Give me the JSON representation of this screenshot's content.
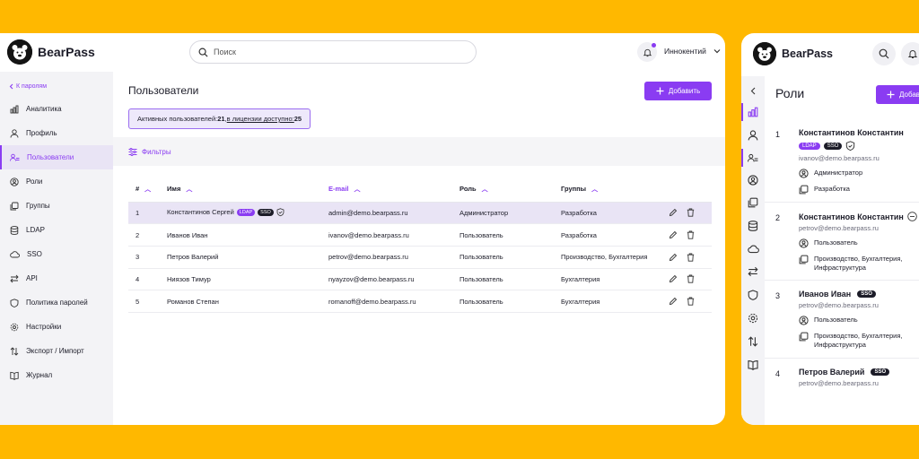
{
  "colors": {
    "accent": "#8A3CF2",
    "background": "#FFB800",
    "badge_sso": "#1c1c28"
  },
  "app": {
    "name": "BearPass"
  },
  "header": {
    "search_placeholder": "Поиск",
    "user_name": "Иннокентий"
  },
  "sidebar": {
    "back_label": "К паролям",
    "items": [
      {
        "label": "Аналитика",
        "icon": "analytics-icon"
      },
      {
        "label": "Профиль",
        "icon": "profile-icon"
      },
      {
        "label": "Пользователи",
        "icon": "users-icon",
        "active": true
      },
      {
        "label": "Роли",
        "icon": "roles-icon"
      },
      {
        "label": "Группы",
        "icon": "groups-icon"
      },
      {
        "label": "LDAP",
        "icon": "database-icon"
      },
      {
        "label": "SSO",
        "icon": "cloud-icon"
      },
      {
        "label": "API",
        "icon": "api-icon"
      },
      {
        "label": "Политика паролей",
        "icon": "shield-icon"
      },
      {
        "label": "Настройки",
        "icon": "gear-icon"
      },
      {
        "label": "Экспорт / Импорт",
        "icon": "import-export-icon"
      },
      {
        "label": "Журнал",
        "icon": "book-icon"
      }
    ]
  },
  "main": {
    "title": "Пользователи",
    "add_label": "Добавить",
    "license": {
      "prefix": "Активных пользователей: ",
      "active_count": "21",
      "sep": ", ",
      "link_text": "в лицензии доступно:",
      "space": " ",
      "available": "25"
    },
    "filters_label": "Фильтры",
    "columns": [
      "#",
      "Имя",
      "E-mail",
      "Роль",
      "Группы"
    ],
    "rows": [
      {
        "num": "1",
        "name": "Константинов Сергей",
        "badges": [
          "LDAP",
          "SSO"
        ],
        "email": "admin@demo.bearpass.ru",
        "role": "Администратор",
        "groups": "Разработка"
      },
      {
        "num": "2",
        "name": "Иванов Иван",
        "badges": [],
        "email": "ivanov@demo.bearpass.ru",
        "role": "Пользователь",
        "groups": "Разработка"
      },
      {
        "num": "3",
        "name": "Петров Валерий",
        "badges": [],
        "email": "petrov@demo.bearpass.ru",
        "role": "Пользователь",
        "groups": "Производство, Бухгалтерия"
      },
      {
        "num": "4",
        "name": "Ниязов Тимур",
        "badges": [],
        "email": "nyayzov@demo.bearpass.ru",
        "role": "Пользователь",
        "groups": "Бухгалтерия"
      },
      {
        "num": "5",
        "name": "Романов Степан",
        "badges": [],
        "email": "romanoff@demo.bearpass.ru",
        "role": "Пользователь",
        "groups": "Бухгалтерия"
      }
    ]
  },
  "mobile": {
    "title": "Роли",
    "add_label": "Добавить",
    "users": [
      {
        "num": "1",
        "name": "Константинов Константин",
        "badges": [
          "LDAP",
          "SSO"
        ],
        "email": "ivanov@demo.bearpass.ru",
        "role": "Администратор",
        "groups": "Разработка"
      },
      {
        "num": "2",
        "name": "Константинов Константин",
        "badges": [],
        "email": "petrov@demo.bearpass.ru",
        "role": "Пользователь",
        "groups": "Производство, Бухгалтерия, Инфраструктура"
      },
      {
        "num": "3",
        "name": "Иванов Иван",
        "badges": [
          "SSO"
        ],
        "email": "petrov@demo.bearpass.ru",
        "role": "Пользователь",
        "groups": "Производство, Бухгалтерия, Инфраструктура"
      },
      {
        "num": "4",
        "name": "Петров Валерий",
        "badges": [
          "SSO"
        ],
        "email": "petrov@demo.bearpass.ru"
      }
    ]
  }
}
